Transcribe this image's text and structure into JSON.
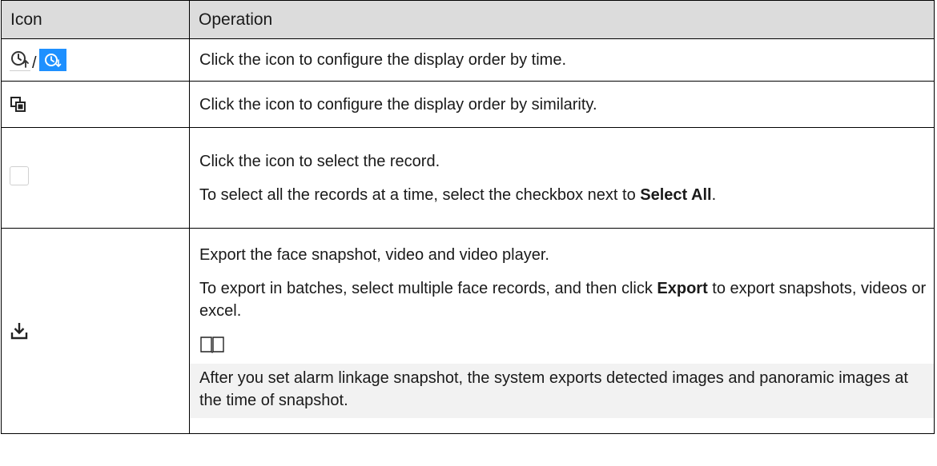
{
  "table": {
    "headers": {
      "icon": "Icon",
      "operation": "Operation"
    },
    "rows": [
      {
        "icons": [
          "sort-by-time-icon",
          "sort-by-time-active-icon"
        ],
        "separator": "/",
        "operation": [
          "Click the icon to configure the display order by time."
        ]
      },
      {
        "icons": [
          "sort-by-similarity-icon"
        ],
        "operation": [
          "Click the icon to configure the display order by similarity."
        ]
      },
      {
        "icons": [
          "checkbox-icon"
        ],
        "operation": [
          "Click the icon to select the record.",
          "To select all the records at a time, select the checkbox next to ",
          "Select All",
          "."
        ]
      },
      {
        "icons": [
          "download-icon"
        ],
        "operation": [
          "Export the face snapshot, video and video player.",
          "To export in batches, select multiple face records, and then click ",
          "Export",
          " to export snapshots, videos or excel."
        ],
        "note": {
          "icon": "book-icon",
          "text": "After you set alarm linkage snapshot, the system exports detected images and panoramic images at the time of snapshot."
        }
      }
    ]
  },
  "colors": {
    "header_bg": "#dcdcdc",
    "active_icon_bg": "#1e90ff",
    "note_bg": "#f2f2f2"
  }
}
